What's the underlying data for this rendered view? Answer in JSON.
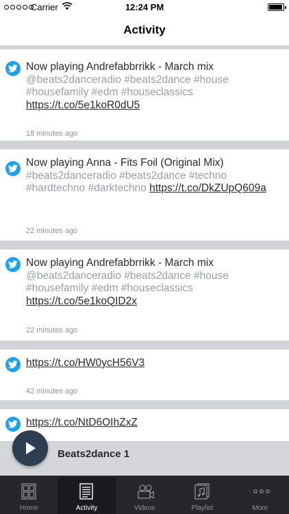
{
  "status_bar": {
    "carrier": "Carrier",
    "time": "12:24 PM"
  },
  "nav": {
    "title": "Activity"
  },
  "feed": [
    {
      "text": "Now playing Andrefabbrrikk - March mix",
      "tags": "@beats2danceradio #beats2dance #house #housefamily #edm #houseclassics",
      "link": "https://t.co/5e1koR0dU5",
      "time": "18 minutes ago"
    },
    {
      "text": "Now playing Anna - Fits Foil (Original Mix)",
      "tags": "#beats2danceradio #beats2dance #techno #hardtechno #darktechno",
      "link": "https://t.co/DkZUpQ609a",
      "time": "22 minutes ago"
    },
    {
      "text": "Now playing Andrefabbrrikk - March mix",
      "tags": "@beats2danceradio #beats2dance #house #housefamily #edm #houseclassics",
      "link": "https://t.co/5e1koQID2x",
      "time": "22 minutes ago"
    },
    {
      "text": "",
      "tags": "",
      "link": "https://t.co/HW0ycH56V3",
      "time": "42 minutes ago"
    },
    {
      "text": "",
      "tags": "",
      "link": "https://t.co/NtD6OIhZxZ",
      "time": ""
    }
  ],
  "player": {
    "title": "Beats2dance 1"
  },
  "tabs": [
    {
      "label": "Home",
      "icon": "home-grid-icon"
    },
    {
      "label": "Activity",
      "icon": "activity-list-icon"
    },
    {
      "label": "Videos",
      "icon": "videos-tape-icon"
    },
    {
      "label": "Playlist",
      "icon": "playlist-music-icon"
    },
    {
      "label": "More",
      "icon": "more-dots-icon"
    }
  ],
  "colors": {
    "twitter": "#1da1f2",
    "tabbar": "#25272c",
    "play_button": "#2c3e50",
    "hashtag": "#9a9ea6"
  }
}
